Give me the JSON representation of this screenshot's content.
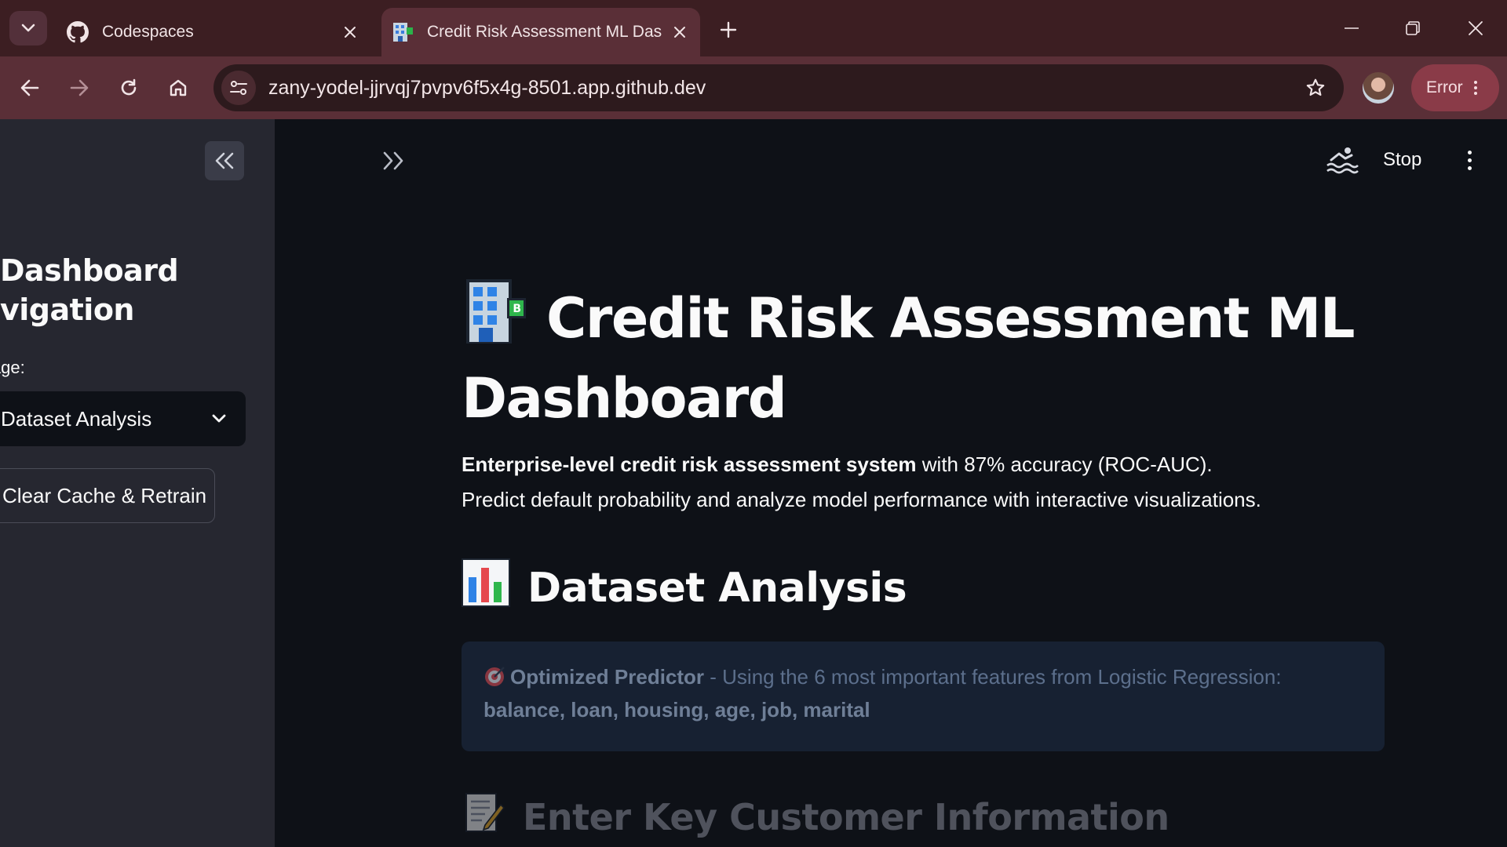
{
  "browser": {
    "tabs": [
      {
        "title": "Codespaces",
        "icon": "github-icon"
      },
      {
        "title": "Credit Risk Assessment ML Das",
        "icon": "bank-building-icon"
      }
    ],
    "url": "zany-yodel-jjrvqj7pvpv6f5x4g-8501.app.github.dev",
    "status_label": "Error"
  },
  "sidebar": {
    "title_line1": "Dashboard",
    "title_line2": "vigation",
    "select_label": "e a page:",
    "selected_page": "Dataset Analysis",
    "action_button": "Clear Cache & Retrain"
  },
  "header": {
    "stop_label": "Stop"
  },
  "main": {
    "title": "Credit Risk Assessment ML Dashboard",
    "intro_bold": "Enterprise-level credit risk assessment system",
    "intro_rest": " with 87% accuracy (ROC-AUC).",
    "intro_line2": "Predict default probability and analyze model performance with interactive visualizations.",
    "section_title": "Dataset Analysis",
    "info_bold": "Optimized Predictor",
    "info_text": " - Using the 6 most important features from Logistic Regression:",
    "info_features": "balance, loan, housing, age, job, marital",
    "subsection_title": "Enter Key Customer Information"
  },
  "colors": {
    "app_bg": "#0e1117",
    "sidebar_bg": "#262730",
    "browser_frame": "#5a2f37",
    "info_bg": "#172132",
    "error_pill": "#8a3b48"
  }
}
